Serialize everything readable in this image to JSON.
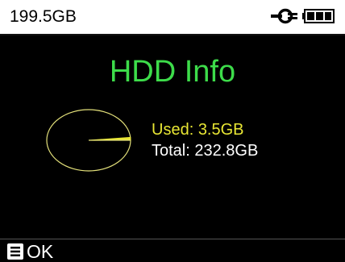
{
  "status_bar": {
    "free_space": "199.5GB",
    "icons": [
      "power-plug-icon",
      "battery-icon"
    ]
  },
  "main": {
    "title": "HDD Info",
    "used_label": "Used:",
    "used_value": "3.5GB",
    "total_label": "Total:",
    "total_value": "232.8GB",
    "used_fraction": 0.015
  },
  "softkey": {
    "icon": "menu-key-icon",
    "label": "OK"
  },
  "colors": {
    "background": "#000000",
    "status_bar": "#ffffff",
    "title": "#3ddc4a",
    "used": "#e8e634",
    "total": "#ffffff"
  }
}
